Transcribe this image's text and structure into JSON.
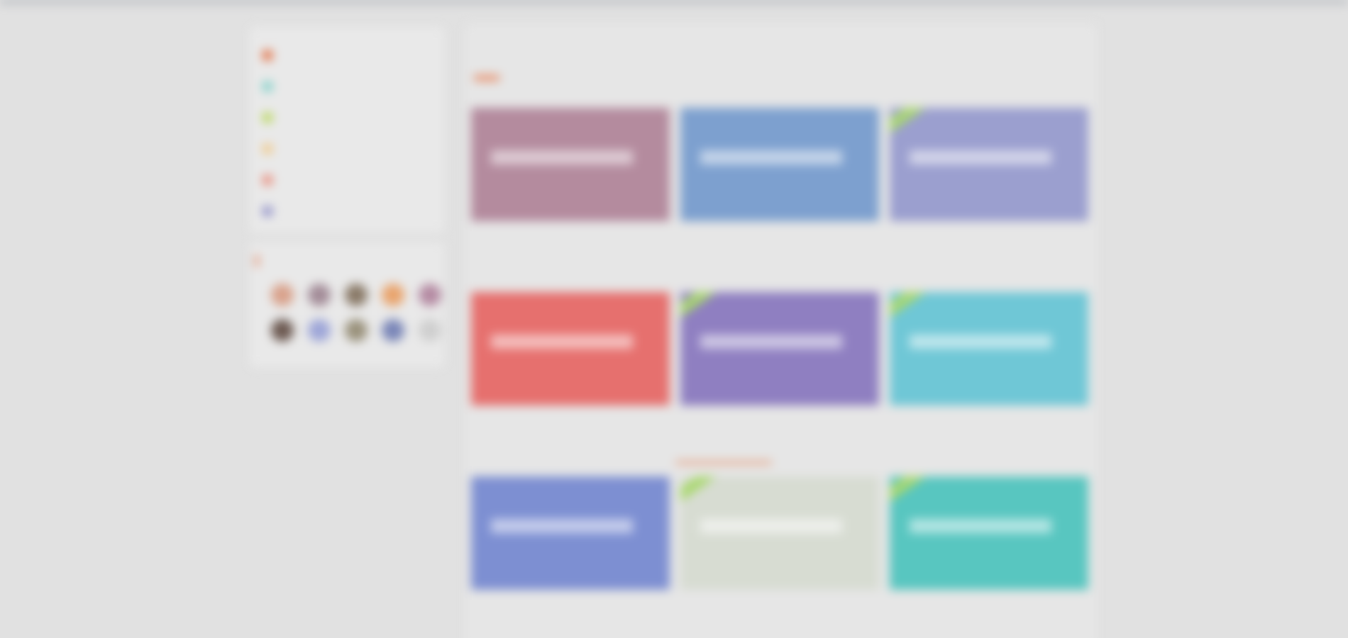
{
  "sidebar": {
    "categories": [
      {
        "label": "",
        "count": "",
        "color": "#e36b3d",
        "active": true,
        "icon": "home-icon"
      },
      {
        "label": "",
        "count": "",
        "color": "#7fd1c9",
        "active": false,
        "icon": "grid-icon"
      },
      {
        "label": "",
        "count": "",
        "color": "#b9d85a",
        "active": false,
        "icon": "leaf-icon"
      },
      {
        "label": "",
        "count": "",
        "color": "#f0c98a",
        "active": false,
        "icon": "star-icon"
      },
      {
        "label": "",
        "count": "",
        "color": "#e98b7a",
        "active": false,
        "icon": "flag-icon"
      },
      {
        "label": "",
        "count": "",
        "color": "#8f8fc8",
        "active": false,
        "icon": "bookmark-icon"
      }
    ],
    "authors": {
      "title": "",
      "avatars": [
        {
          "color": "#d9a28c"
        },
        {
          "color": "#a38c98"
        },
        {
          "color": "#8a7a68"
        },
        {
          "color": "#e9a46d"
        },
        {
          "color": "#b58ba3"
        },
        {
          "color": "#6d5a52"
        },
        {
          "color": "#9ea6d8"
        },
        {
          "color": "#9a927c"
        },
        {
          "color": "#7a86b8"
        },
        {
          "color": "#cfcfcf"
        }
      ]
    }
  },
  "main": {
    "tabs": [
      {
        "label": "",
        "active": true
      },
      {
        "label": "",
        "active": false
      }
    ],
    "subtabs": [
      {
        "label": "",
        "active": true
      },
      {
        "label": "",
        "active": false
      }
    ],
    "cards": [
      {
        "title": "",
        "author": "",
        "date": "",
        "views": "",
        "bg": "#b48b9e",
        "new": false
      },
      {
        "title": "",
        "author": "",
        "date": "",
        "views": "",
        "bg": "#7da0cf",
        "new": false
      },
      {
        "title": "",
        "author": "",
        "date": "",
        "views": "",
        "bg": "#9b9fcf",
        "new": true
      },
      {
        "title": "",
        "author": "",
        "date": "",
        "views": "",
        "bg": "#e6706e",
        "new": false
      },
      {
        "title": "",
        "author": "",
        "date": "",
        "views": "",
        "bg": "#8f7fc1",
        "new": true
      },
      {
        "title": "",
        "author": "",
        "date": "",
        "views": "",
        "bg": "#6fc7d6",
        "new": true
      },
      {
        "title": "",
        "author": "",
        "date": "",
        "views": "",
        "bg": "#7d8fd2",
        "new": false
      },
      {
        "title": "",
        "author": "",
        "date": "",
        "views": "",
        "bg": "#d7dcd2",
        "new": true
      },
      {
        "title": "",
        "author": "",
        "date": "",
        "views": "",
        "bg": "#58c6c0",
        "new": true
      }
    ]
  },
  "colors": {
    "accent": "#e36b3d",
    "page_background": "#e1e1e1",
    "panel_background": "#e9e9e9"
  }
}
